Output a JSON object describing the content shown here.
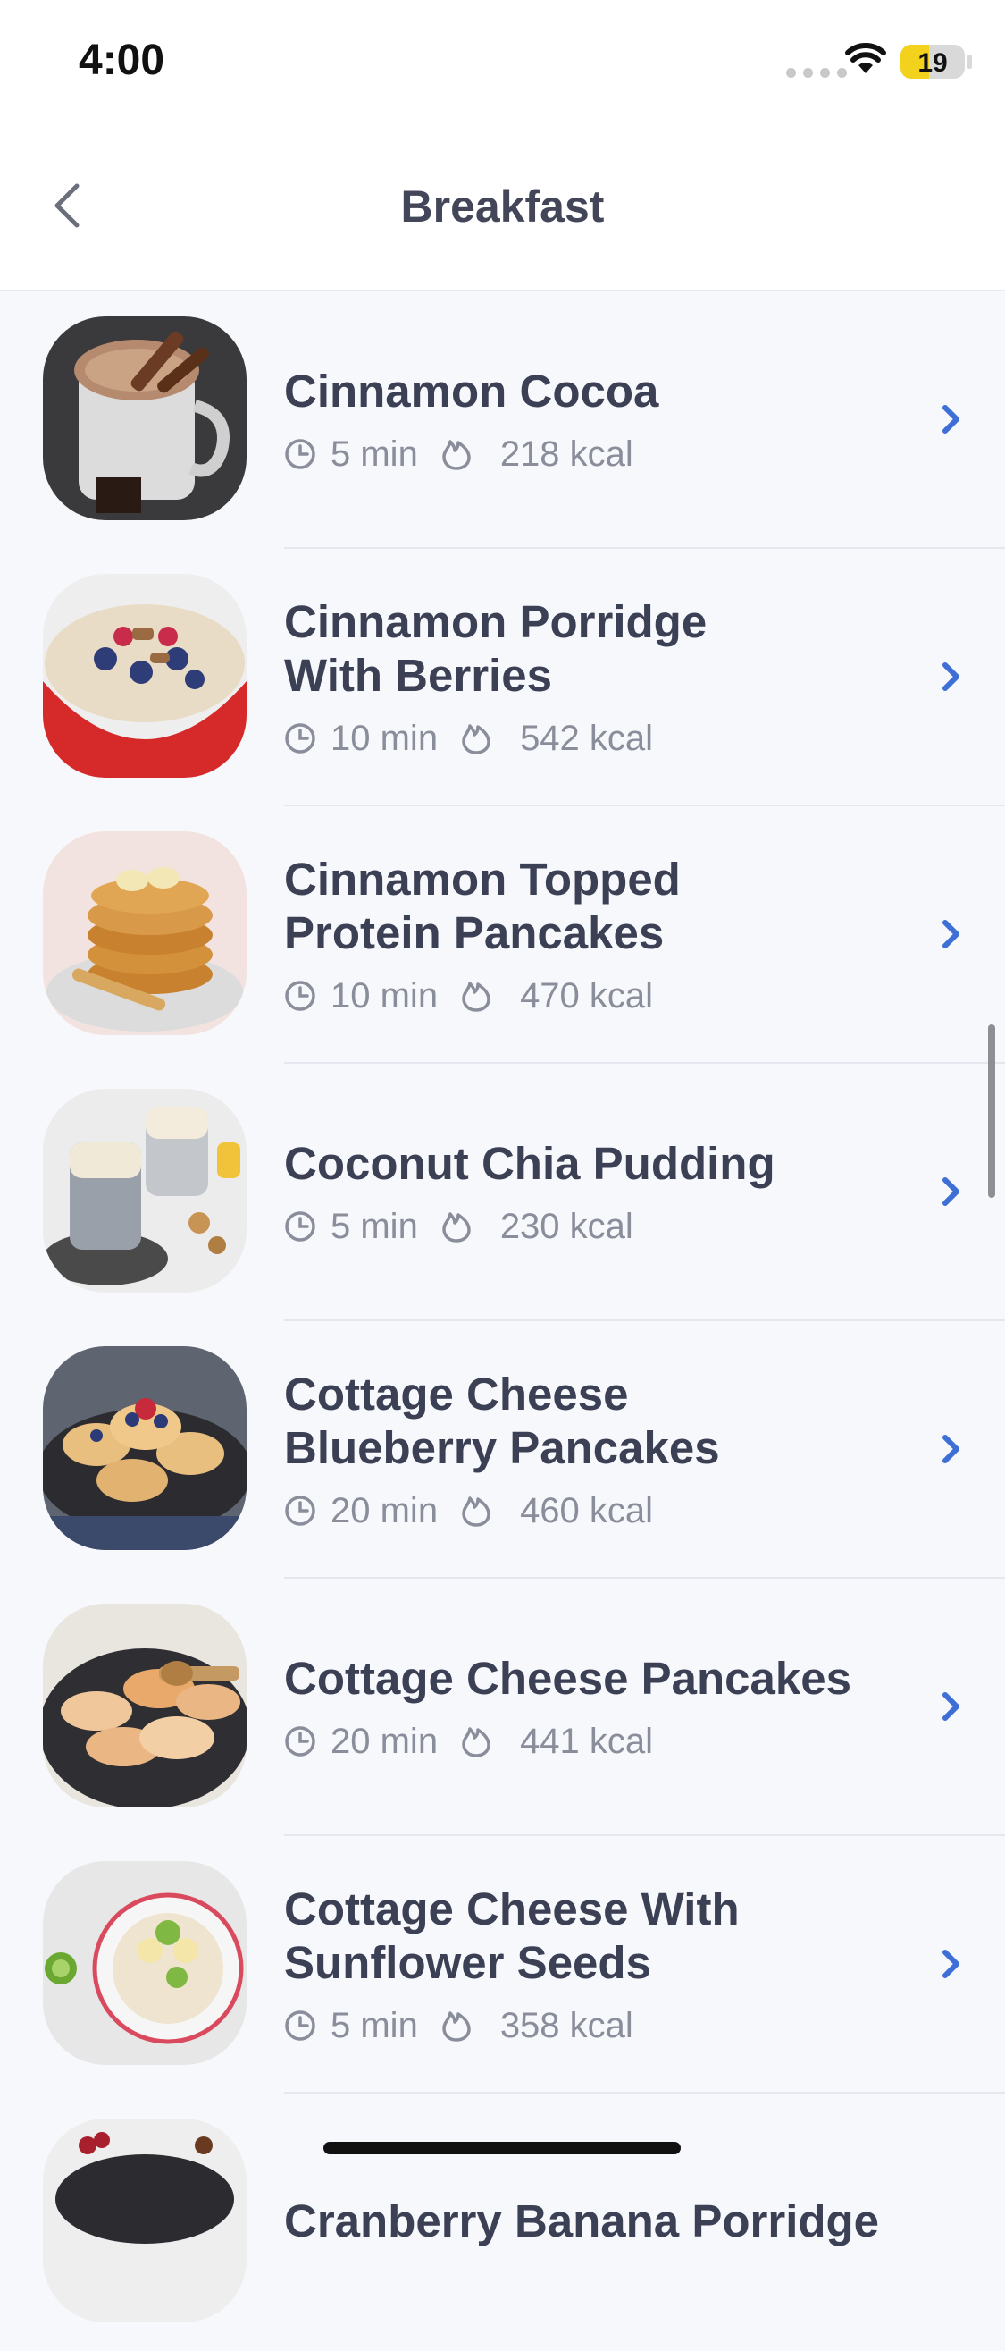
{
  "status_bar": {
    "time": "4:00",
    "battery_level": "19",
    "battery_fraction": 0.19
  },
  "nav": {
    "title": "Breakfast",
    "back_icon": "chevron-left-icon"
  },
  "icons": {
    "time": "clock-icon",
    "calories": "flame-icon",
    "open": "chevron-right-icon"
  },
  "colors": {
    "accent": "#3d6fd6",
    "title": "#3c4055",
    "meta": "#8a8e9b"
  },
  "recipes": [
    {
      "name": "Cinnamon Cocoa",
      "time": "5 min",
      "kcal": "218 kcal"
    },
    {
      "name": "Cinnamon Porridge With Berries",
      "time": "10 min",
      "kcal": "542 kcal"
    },
    {
      "name": "Cinnamon Topped Protein Pancakes",
      "time": "10 min",
      "kcal": "470 kcal"
    },
    {
      "name": "Coconut Chia Pudding",
      "time": "5 min",
      "kcal": "230 kcal"
    },
    {
      "name": "Cottage Cheese Blueberry Pancakes",
      "time": "20 min",
      "kcal": "460 kcal"
    },
    {
      "name": "Cottage Cheese Pancakes",
      "time": "20 min",
      "kcal": "441 kcal"
    },
    {
      "name": "Cottage Cheese With Sunflower Seeds",
      "time": "5 min",
      "kcal": "358 kcal"
    },
    {
      "name": "Cranberry Banana Porridge",
      "time": "",
      "kcal": ""
    }
  ]
}
